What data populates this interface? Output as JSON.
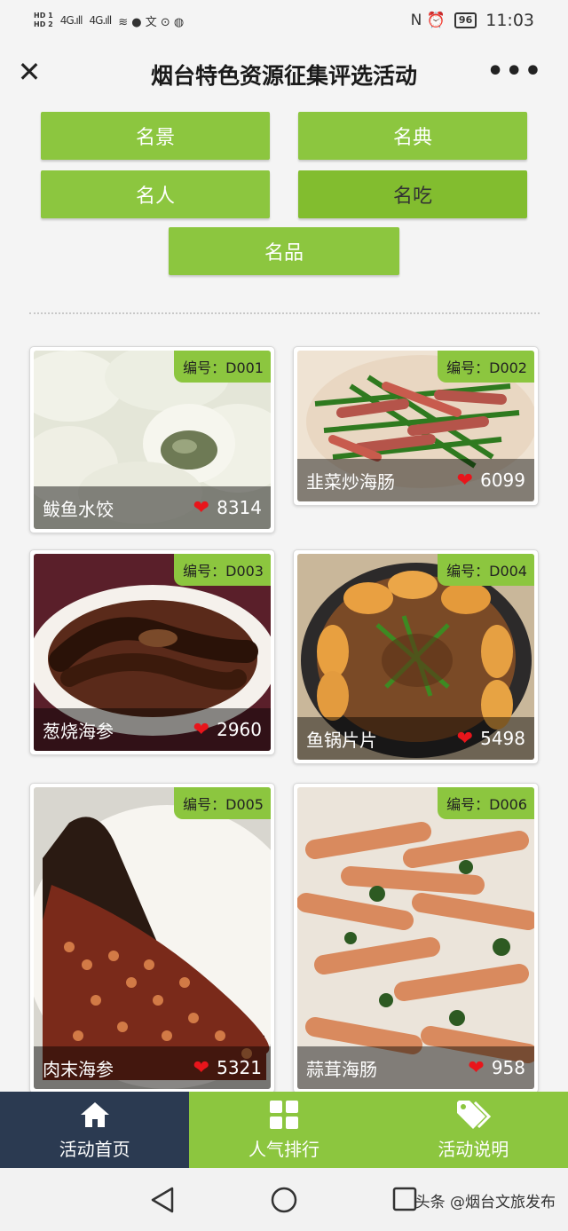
{
  "status_bar": {
    "hd1": "HD 1",
    "hd2": "HD 2",
    "signal1": "4G.ıll",
    "signal2": "4G.ıll",
    "left_icons": "≋ ● 文 ⊙ ◍",
    "right_icons": "N ⏰",
    "battery": "96",
    "time": "11:03"
  },
  "header": {
    "close_icon": "✕",
    "title": "烟台特色资源征集评选活动",
    "more_icon": "•••"
  },
  "categories": [
    {
      "label": "名景"
    },
    {
      "label": "名典"
    },
    {
      "label": "名人"
    },
    {
      "label": "名吃"
    },
    {
      "label": "名品"
    }
  ],
  "active_category": "名吃",
  "cards": [
    {
      "code": "编号：D001",
      "name": "鲅鱼水饺",
      "votes": "8314"
    },
    {
      "code": "编号：D002",
      "name": "韭菜炒海肠",
      "votes": "6099"
    },
    {
      "code": "编号：D003",
      "name": "葱烧海参",
      "votes": "2960"
    },
    {
      "code": "编号：D004",
      "name": "鱼锅片片",
      "votes": "5498"
    },
    {
      "code": "编号：D005",
      "name": "肉末海参",
      "votes": "5321"
    },
    {
      "code": "编号：D006",
      "name": "蒜茸海肠",
      "votes": "958"
    }
  ],
  "heart_icon": "❤",
  "bottom_nav": [
    {
      "label": "活动首页",
      "icon": "home-icon"
    },
    {
      "label": "人气排行",
      "icon": "grid-icon"
    },
    {
      "label": "活动说明",
      "icon": "tag-icon"
    }
  ],
  "watermark": "头条 @烟台文旅发布",
  "colors": {
    "accent": "#8cc63f",
    "nav_active": "#2b3a51",
    "heart": "#e8151b"
  }
}
